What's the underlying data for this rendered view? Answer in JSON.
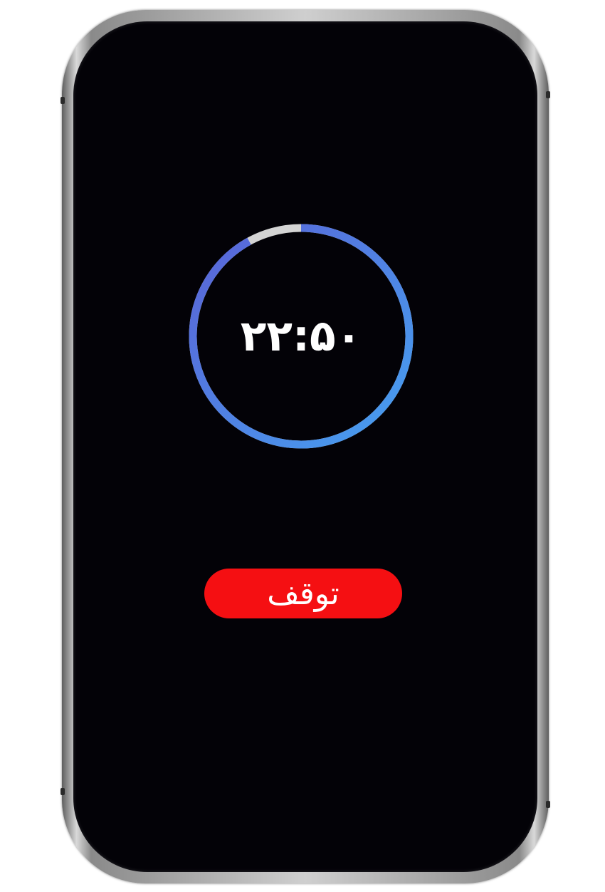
{
  "timer": {
    "time_text": "۲۲:۵۰",
    "progress": 0.92,
    "track_color": "#d4d4d4",
    "gradient_start": "#46a0f0",
    "gradient_end": "#5a62d6"
  },
  "actions": {
    "stop_label": "توقف",
    "stop_color": "#f50f12"
  }
}
